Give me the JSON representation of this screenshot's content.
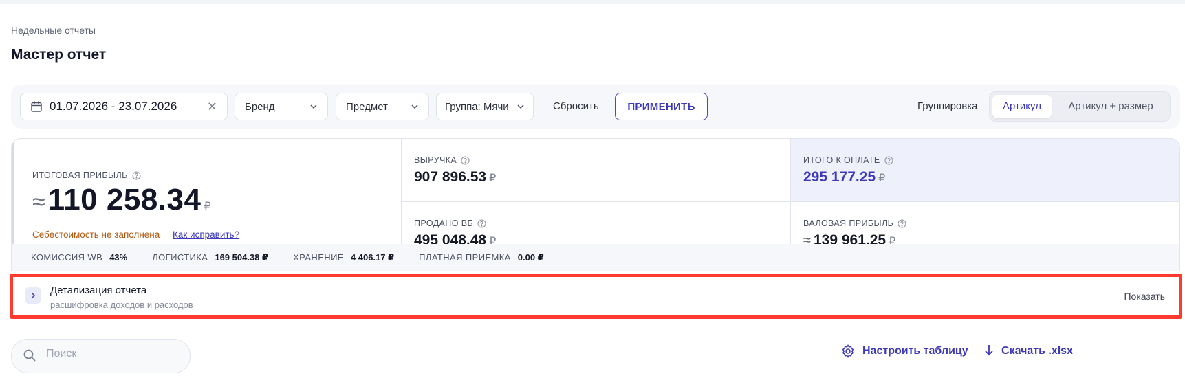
{
  "header": {
    "breadcrumb": "Недельные отчеты",
    "title": "Мастер отчет"
  },
  "filters": {
    "date_range": "01.07.2026 - 23.07.2026",
    "brand": "Бренд",
    "subject": "Предмет",
    "group": "Группа: Мячи",
    "reset_label": "Сбросить",
    "apply_label": "ПРИМЕНИТЬ",
    "grouping_label": "Группировка",
    "grouping_options": [
      "Артикул",
      "Артикул + размер"
    ],
    "grouping_selected": "Артикул"
  },
  "kpi": {
    "profit": {
      "label": "ИТОГОВАЯ ПРИБЫЛЬ",
      "approx": "≈",
      "value": "110 258.34",
      "currency": "₽",
      "warning": "Себестоимость не заполнена",
      "fix_link": "Как исправить?"
    },
    "revenue": {
      "label": "ВЫРУЧКА",
      "value": "907 896.53",
      "currency": "₽"
    },
    "sold": {
      "label": "ПРОДАНО ВБ",
      "value": "495 048.48",
      "currency": "₽"
    },
    "payout": {
      "label": "ИТОГО К ОПЛАТЕ",
      "value": "295 177.25",
      "currency": "₽"
    },
    "gross": {
      "label": "ВАЛОВАЯ ПРИБЫЛЬ",
      "approx": "≈",
      "value": "139 961.25",
      "currency": "₽"
    }
  },
  "stats": [
    {
      "key": "КОМИССИЯ WB",
      "value": "43%"
    },
    {
      "key": "ЛОГИСТИКА",
      "value": "169 504.38 ₽"
    },
    {
      "key": "ХРАНЕНИЕ",
      "value": "4 406.17 ₽"
    },
    {
      "key": "ПЛАТНАЯ ПРИЕМКА",
      "value": "0.00 ₽"
    }
  ],
  "detail": {
    "title": "Детализация отчета",
    "subtitle": "расшифровка доходов и расходов",
    "show_label": "Показать"
  },
  "toolbar": {
    "search_placeholder": "Поиск",
    "configure_label": "Настроить таблицу",
    "download_label": "Скачать .xlsx"
  },
  "colors": {
    "accent": "#3d39b8",
    "warning": "#b2590f",
    "highlight_border": "#ff3b30",
    "payout_bg": "#eef0fc"
  }
}
